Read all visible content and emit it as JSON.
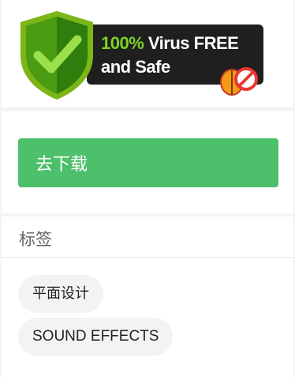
{
  "badge": {
    "line1_pct": "100%",
    "line1_rest": " Virus FREE",
    "line2": "and Safe"
  },
  "download": {
    "label": "去下载",
    "color": "#4cc06a"
  },
  "tags": {
    "title": "标签",
    "items": [
      "平面设计",
      "SOUND EFFECTS"
    ]
  }
}
